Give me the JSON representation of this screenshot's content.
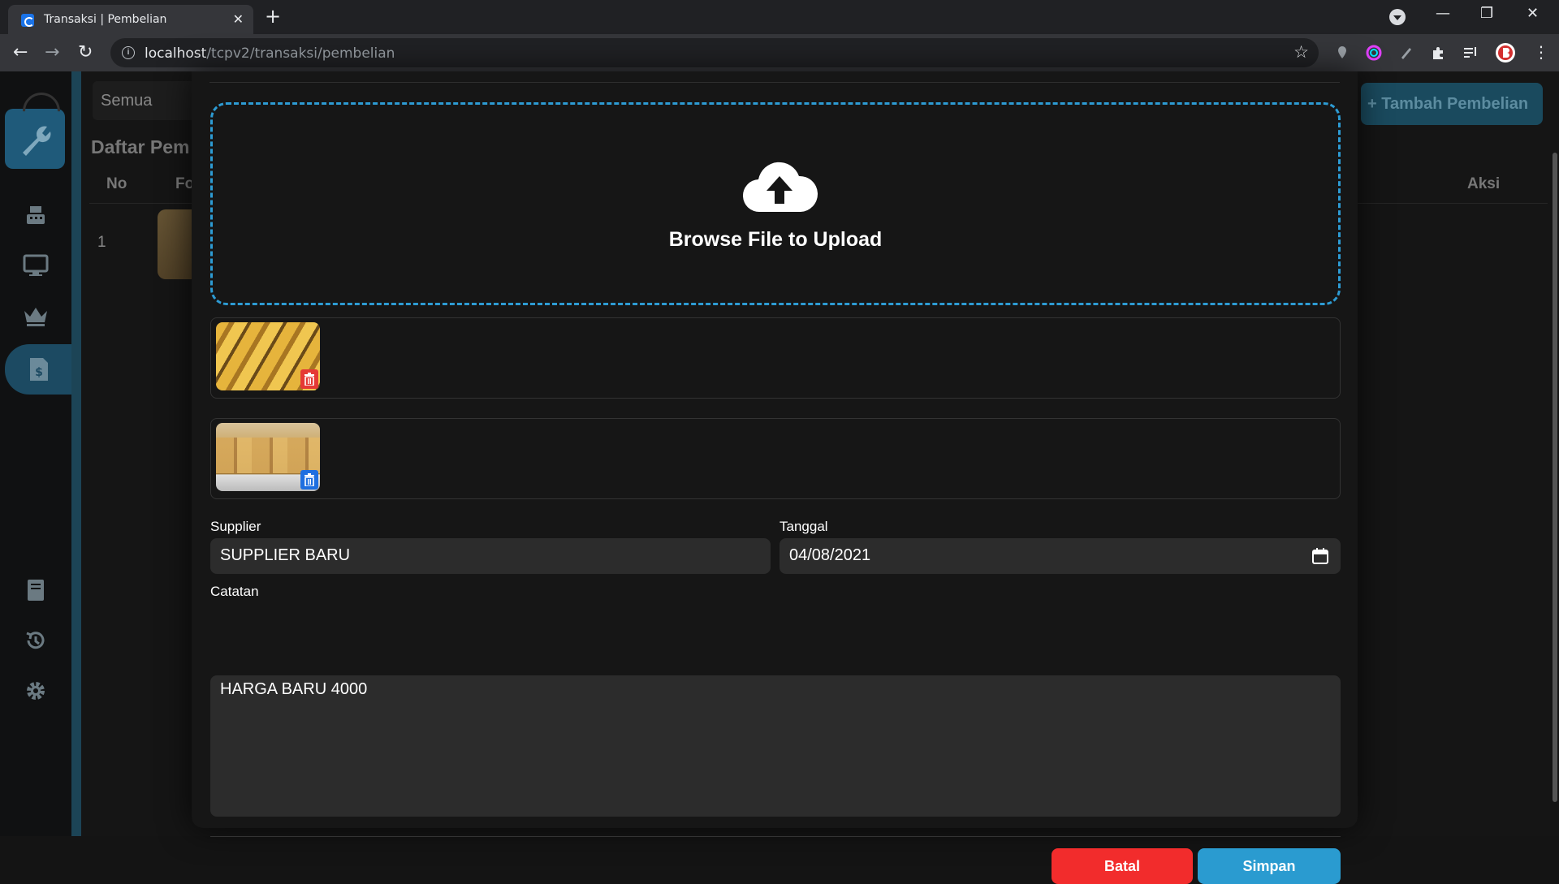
{
  "browser": {
    "tab_title": "Transaksi | Pembelian",
    "url_host": "localhost",
    "url_path": "/tcpv2/transaksi/pembelian"
  },
  "background_page": {
    "filter_value": "Semua",
    "list_title": "Daftar Pem",
    "columns": [
      "No",
      "Fo",
      "Aksi"
    ],
    "rows": [
      {
        "no": "1"
      }
    ],
    "add_button_label": "Tambah Pembelian",
    "sidebar_icons": [
      "wrench-icon",
      "cash-register-icon",
      "monitor-icon",
      "crown-icon",
      "invoice-icon",
      "book-icon",
      "history-icon",
      "gear-icon"
    ]
  },
  "modal": {
    "upload_text": "Browse File to Upload",
    "supplier_label": "Supplier",
    "supplier_value": "SUPPLIER BARU",
    "tanggal_label": "Tanggal",
    "tanggal_value": "04/08/2021",
    "catatan_label": "Catatan",
    "catatan_value": "HARGA BARU 4000",
    "batal_label": "Batal",
    "simpan_label": "Simpan"
  },
  "colors": {
    "accent": "#2a9bd0",
    "danger": "#f22c2c",
    "dropzone_border": "#2d9bd3",
    "modal_bg": "#161616",
    "input_bg": "#2c2c2c"
  }
}
